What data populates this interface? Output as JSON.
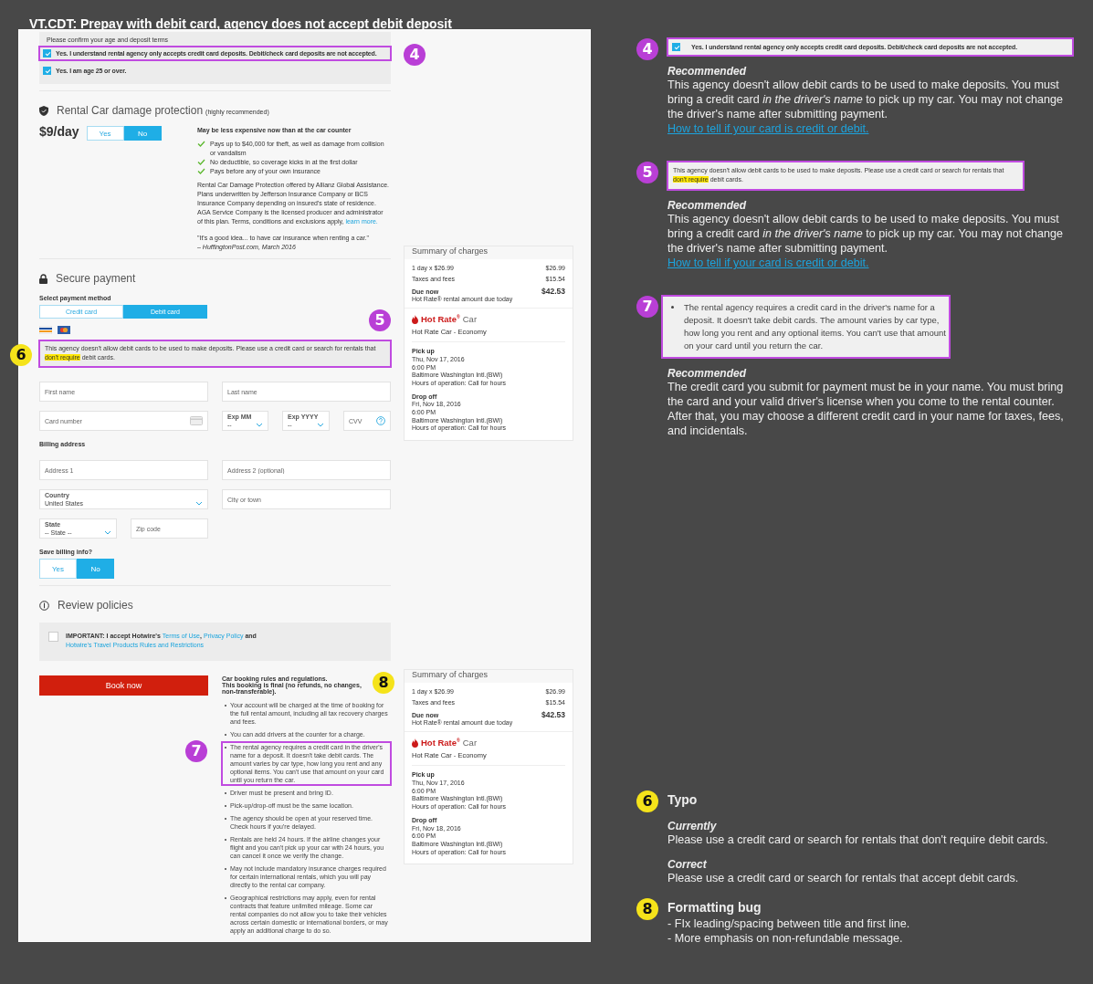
{
  "title": "VT.CDT: Prepay with debit card, agency does not accept debit deposit",
  "terms": {
    "heading": "Please confirm your age and deposit terms",
    "items": [
      {
        "label": "Yes. I understand rental agency only accepts credit card deposits. Debit/check card deposits are not accepted.",
        "checked": true,
        "outlined": true,
        "callouts": [
          {
            "number": "4",
            "color": "#b93fd6"
          }
        ]
      },
      {
        "label": "Yes. I am age 25 or over.",
        "checked": true,
        "outlined": false
      }
    ]
  },
  "protection": {
    "title": "Rental Car damage protection",
    "note": "(highly recommended)",
    "price": "$9/day",
    "options": [
      {
        "label": "Yes",
        "selected": false
      },
      {
        "label": "No",
        "selected": true
      }
    ],
    "headline": "May be less expensive now than at the car counter",
    "benefits": [
      "Pays up to $40,000 for theft, as well as damage from collision or vandalism",
      "No deductible, so coverage kicks in at the first dollar",
      "Pays before any of your own insurance"
    ],
    "disclaimer": "Rental Car Damage Protection offered by Allianz Global Assistance. Plans underwritten by Jefferson Insurance Company or BCS Insurance Company depending on insured's state of residence. AGA Service Company is the licensed producer and administrator of this plan. Terms, conditions and exclusions apply,",
    "link": "learn more.",
    "quote": "\"It's a good idea... to have car insurance when renting a car.\"",
    "quote_source": "– HuffingtonPost.com, March 2016"
  },
  "payment": {
    "title": "Secure payment",
    "method_label": "Select payment method",
    "methods": [
      {
        "label": "Credit card",
        "selected": false
      },
      {
        "label": "Debit card",
        "selected": true
      }
    ],
    "warning": {
      "outlined": true,
      "callouts": [
        {
          "number": "5",
          "color": "#b93fd6"
        },
        {
          "number": "6",
          "color": "#f5e31a"
        }
      ],
      "parts": [
        {
          "text": "This agency doesn't allow debit cards to be used to make deposits. Please use a credit card or search for rentals that ",
          "highlighted": false
        },
        {
          "text": "don't require",
          "highlighted": true
        },
        {
          "text": " debit cards.",
          "highlighted": false
        }
      ]
    },
    "card_rows": [
      {
        "kind": "pair",
        "fields": [
          {
            "kind": "text",
            "placeholder": "First name"
          },
          {
            "kind": "text",
            "placeholder": "Last name"
          }
        ]
      },
      {
        "kind": "card",
        "fields": [
          {
            "kind": "card",
            "placeholder": "Card number"
          },
          {
            "kind": "select",
            "label": "Exp MM",
            "value": "--"
          },
          {
            "kind": "select",
            "label": "Exp YYYY",
            "value": "--"
          },
          {
            "kind": "cvv",
            "placeholder": "CVV"
          }
        ]
      }
    ],
    "billing_label": "Billing address",
    "billing_rows": [
      {
        "kind": "pair",
        "fields": [
          {
            "kind": "text",
            "placeholder": "Address 1"
          },
          {
            "kind": "text",
            "placeholder": "Address 2 (optional)"
          }
        ]
      },
      {
        "kind": "pair",
        "fields": [
          {
            "kind": "select",
            "label": "Country",
            "value": "United States"
          },
          {
            "kind": "text",
            "placeholder": "City or town"
          }
        ]
      },
      {
        "kind": "short",
        "fields": [
          {
            "kind": "select",
            "label": "State",
            "value": "-- State --"
          },
          {
            "kind": "text",
            "placeholder": "Zip code"
          }
        ]
      }
    ],
    "save_label": "Save billing info?",
    "save_options": [
      {
        "label": "Yes",
        "selected": false
      },
      {
        "label": "No",
        "selected": true
      }
    ]
  },
  "policies": {
    "title": "Review policies",
    "accept_checked": false,
    "accept_parts": [
      {
        "kind": "text",
        "text": "IMPORTANT: I accept Hotwire's "
      },
      {
        "kind": "link",
        "text": "Terms of Use"
      },
      {
        "kind": "text",
        "text": ", "
      },
      {
        "kind": "link",
        "text": "Privacy Policy"
      },
      {
        "kind": "text",
        "text": " and "
      },
      {
        "kind": "link",
        "text": "Hotwire's Travel Products Rules and Restrictions"
      }
    ],
    "book_button": "Book now",
    "rules_title": "Car booking rules and regulations.",
    "rules_subtitle": "This booking is final (no refunds, no changes, non-transferable).",
    "rules_callouts": [
      {
        "number": "8",
        "color": "#f5e31a"
      }
    ],
    "rules": [
      {
        "text": "Your account will be charged at the time of booking for the full rental amount, including all tax recovery charges and fees.",
        "outlined": false
      },
      {
        "text": "You can add drivers at the counter for a charge.",
        "outlined": false
      },
      {
        "text": "The rental agency requires a credit card in the driver's name for a deposit. It doesn't take debit cards. The amount varies by car type, how long you rent and any optional items. You can't use that amount on your card until you return the car.",
        "outlined": true,
        "callouts": [
          {
            "number": "7",
            "color": "#b93fd6"
          }
        ]
      },
      {
        "text": "Driver must be present and bring ID.",
        "outlined": false
      },
      {
        "text": "Pick-up/drop-off must be the same location.",
        "outlined": false
      },
      {
        "text": "The agency should be open at your reserved time. Check hours if you're delayed.",
        "outlined": false
      },
      {
        "text": "Rentals are held 24 hours. If the airline changes your flight and you can't pick up your car with 24 hours, you can cancel it once we verify the change.",
        "outlined": false
      },
      {
        "text": "May not include mandatory insurance charges required for certain international rentals, which you will pay directly to the rental car company.",
        "outlined": false
      },
      {
        "text": "Geographical restrictions may apply, even for rental contracts that feature unlimited mileage. Some car rental companies do not allow you to take their vehicles across certain domestic or international borders, or may apply an additional charge to do so.",
        "outlined": false
      }
    ]
  },
  "summaries": [
    {
      "title": "Summary of charges",
      "lines": [
        {
          "label": "1 day x $26.99",
          "amount": "$26.99"
        },
        {
          "label": "Taxes and fees",
          "amount": "$15.54"
        }
      ],
      "due_label": "Due now",
      "due_amount": "$42.53",
      "due_note": "Hot Rate® rental amount due today",
      "brand": "Hot Rate$^{®}$",
      "brand_suffix": "Car",
      "car": "Hot Rate Car - Economy",
      "stops": [
        {
          "label": "Pick up",
          "lines": [
            "Thu, Nov 17, 2016",
            "6:00 PM",
            "Baltimore Washington Intl.(BWI)",
            "Hours of operation: Call for hours"
          ]
        },
        {
          "label": "Drop off",
          "lines": [
            "Fri, Nov 18, 2016",
            "6:00 PM",
            "Baltimore Washington Intl.(BWI)",
            "Hours of operation: Call for hours"
          ]
        }
      ]
    },
    {
      "title": "Summary of charges",
      "lines": [
        {
          "label": "1 day x $26.99",
          "amount": "$26.99"
        },
        {
          "label": "Taxes and fees",
          "amount": "$15.54"
        }
      ],
      "due_label": "Due now",
      "due_amount": "$42.53",
      "due_note": "Hot Rate® rental amount due today",
      "brand": "Hot Rate$^{®}$",
      "brand_suffix": "Car",
      "car": "Hot Rate Car - Economy",
      "stops": [
        {
          "label": "Pick up",
          "lines": [
            "Thu, Nov 17, 2016",
            "6:00 PM",
            "Baltimore Washington Intl.(BWI)",
            "Hours of operation: Call for hours"
          ]
        },
        {
          "label": "Drop off",
          "lines": [
            "Fri, Nov 18, 2016",
            "6:00 PM",
            "Baltimore Washington Intl.(BWI)",
            "Hours of operation: Call for hours"
          ]
        }
      ]
    }
  ],
  "notes_top": [
    {
      "kind": "checkbox",
      "number": "4",
      "color": "#b93fd6",
      "clip_text": "Yes. I understand rental agency only accepts credit card deposits. Debit/check card deposits are not accepted.",
      "clip_checked": true,
      "heading": "Recommended",
      "body": "This agency doesn't allow debit cards to be used to make deposits. You must bring a credit card *in the driver's name* to pick up my car. You may not change the driver's name after submitting payment.",
      "link": "How to tell if your card is credit or debit."
    },
    {
      "kind": "warning",
      "number": "5",
      "color": "#b93fd6",
      "clip_parts": [
        {
          "text": "This agency doesn't allow debit cards to be used to make deposits. Please use a credit card or search for rentals that ",
          "highlighted": false
        },
        {
          "text": "don't require",
          "highlighted": true
        },
        {
          "text": " debit cards.",
          "highlighted": false
        }
      ],
      "heading": "Recommended",
      "body": "This agency doesn't allow debit cards to be used to make deposits. You must bring a credit card *in the driver's name* to pick up my car. You may not change the driver's name after submitting payment.",
      "link": "How to tell if your card is credit or debit."
    },
    {
      "kind": "bullet",
      "number": "7",
      "color": "#b93fd6",
      "clip_text": "The rental agency requires a credit card in the driver's name for a deposit. It doesn't take debit cards. The amount varies by car type, how long you rent and any optional items. You can't use that amount on your card until you return the car.",
      "heading": "Recommended",
      "body": "The credit card you submit for payment must be in your name. You must bring the card and your valid driver's license when you come to the rental counter. After that, you may choose a different credit card in your name for taxes, fees, and incidentals."
    }
  ],
  "notes_bottom": [
    {
      "number": "6",
      "color": "#f5e31a",
      "title": "Typo",
      "sections": [
        {
          "label": "Currently",
          "text": "Please use a credit card or search for rentals that don't require debit cards."
        },
        {
          "label": "Correct",
          "text": "Please use a credit card or search for rentals that accept debit cards."
        }
      ]
    },
    {
      "number": "8",
      "color": "#f5e31a",
      "title": "Formatting bug",
      "lines": [
        "- FIx leading/spacing between title and first line.",
        "- More emphasis on non-refundable message."
      ]
    }
  ]
}
